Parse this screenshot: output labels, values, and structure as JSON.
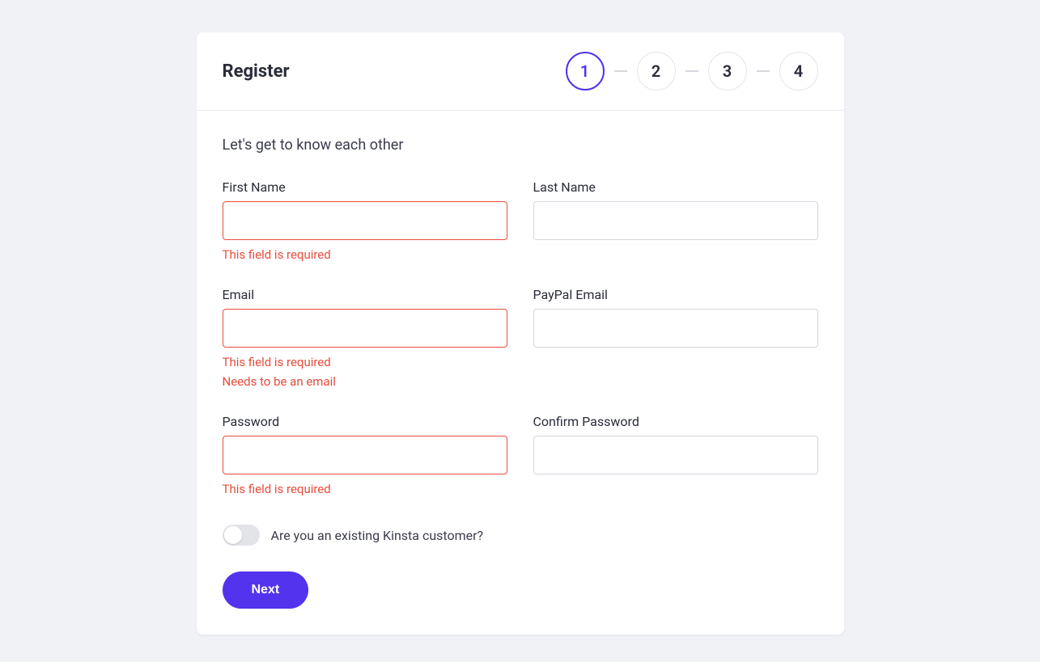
{
  "header": {
    "title": "Register",
    "steps": [
      "1",
      "2",
      "3",
      "4"
    ],
    "activeStep": 0
  },
  "body": {
    "subtitle": "Let's get to know each other",
    "fields": {
      "firstName": {
        "label": "First Name",
        "value": "",
        "errors": [
          "This field is required"
        ]
      },
      "lastName": {
        "label": "Last Name",
        "value": "",
        "errors": []
      },
      "email": {
        "label": "Email",
        "value": "",
        "errors": [
          "This field is required",
          "Needs to be an email"
        ]
      },
      "paypalEmail": {
        "label": "PayPal Email",
        "value": "",
        "errors": []
      },
      "password": {
        "label": "Password",
        "value": "",
        "errors": [
          "This field is required"
        ]
      },
      "confirmPassword": {
        "label": "Confirm Password",
        "value": "",
        "errors": []
      }
    },
    "toggle": {
      "label": "Are you an existing Kinsta customer?",
      "checked": false
    },
    "nextButton": "Next"
  },
  "colors": {
    "primary": "#5333ed",
    "error": "#e74c3c",
    "background": "#f1f2f6",
    "text": "#2a2c3a"
  }
}
